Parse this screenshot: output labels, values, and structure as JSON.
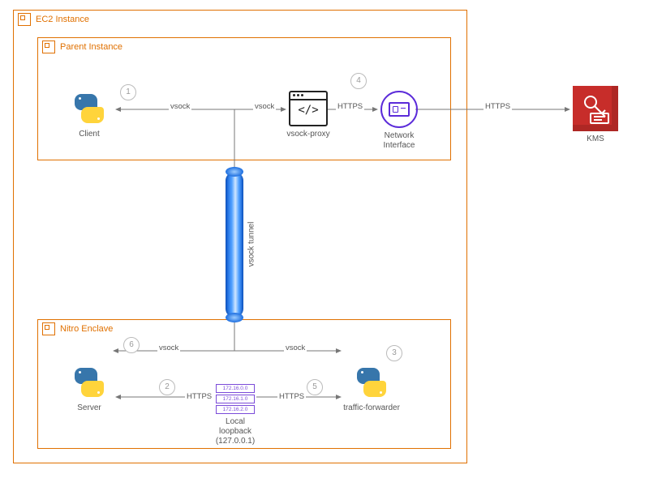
{
  "frames": {
    "ec2": "EC2 Instance",
    "parent": "Parent Instance",
    "nitro": "Nitro Enclave"
  },
  "nodes": {
    "client": "Client",
    "server": "Server",
    "vsock_proxy": "vsock-proxy",
    "network_interface": "Network\nInterface",
    "traffic_forwarder": "traffic-forwarder",
    "kms": "KMS",
    "loopback_caption": "Local loopback\n(127.0.0.1)",
    "loopback_rows": [
      "172.16.0.0",
      "172.16.1.0",
      "172.16.2.0"
    ]
  },
  "edges": {
    "vsock": "vsock",
    "https": "HTTPS",
    "tunnel": "vsock tunnel"
  },
  "steps": {
    "s1": "1",
    "s2": "2",
    "s3": "3",
    "s4": "4",
    "s5": "5",
    "s6": "6"
  },
  "colors": {
    "frame": "#e07000",
    "kms_bg": "#c72d2a",
    "net_purple": "#5b2bd9"
  }
}
